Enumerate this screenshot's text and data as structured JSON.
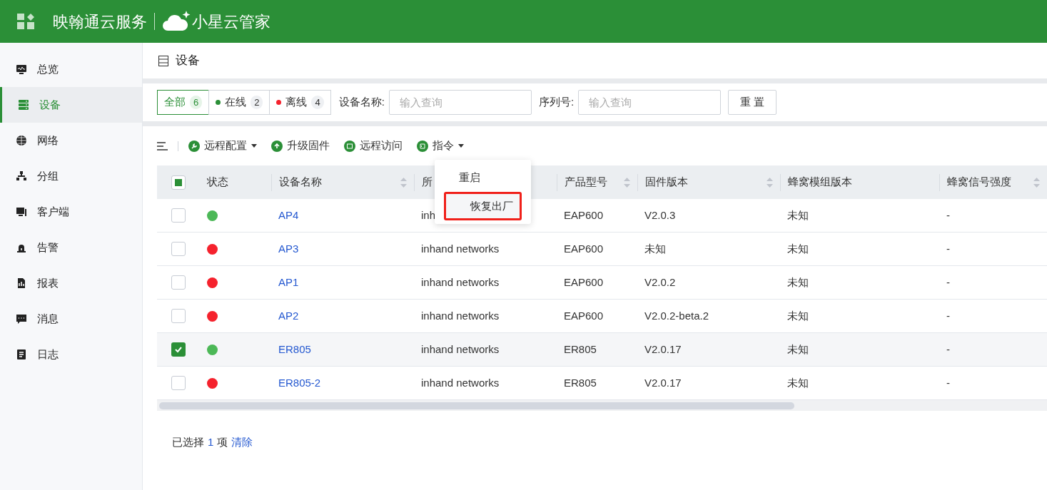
{
  "header": {
    "brand": "映翰通云服务",
    "product": "小星云管家"
  },
  "sidebar": {
    "items": [
      {
        "label": "总览",
        "selected": false
      },
      {
        "label": "设备",
        "selected": true
      },
      {
        "label": "网络",
        "selected": false
      },
      {
        "label": "分组",
        "selected": false
      },
      {
        "label": "客户端",
        "selected": false
      },
      {
        "label": "告警",
        "selected": false
      },
      {
        "label": "报表",
        "selected": false
      },
      {
        "label": "消息",
        "selected": false
      },
      {
        "label": "日志",
        "selected": false
      }
    ]
  },
  "page_title": "设备",
  "filters": {
    "status_tabs": [
      {
        "label": "全部",
        "count": "6",
        "selected": true
      },
      {
        "label": "在线",
        "count": "2",
        "selected": false,
        "color": "#2b8f37"
      },
      {
        "label": "离线",
        "count": "4",
        "selected": false,
        "color": "#f5222d"
      }
    ],
    "fields": [
      {
        "label": "设备名称:",
        "placeholder": "输入查询"
      },
      {
        "label": "序列号:",
        "placeholder": "输入查询"
      }
    ],
    "reset": "重 置"
  },
  "toolbar": [
    {
      "label": "远程配置",
      "dropdown": true
    },
    {
      "label": "升级固件",
      "dropdown": false
    },
    {
      "label": "远程访问",
      "dropdown": false
    },
    {
      "label": "指令",
      "dropdown": true
    }
  ],
  "command_menu": [
    {
      "label": "重启",
      "highlighted": false
    },
    {
      "label": "恢复出厂",
      "highlighted": true
    }
  ],
  "table": {
    "header_checkbox": {
      "indeterminate": true
    },
    "columns": [
      {
        "label": "状态",
        "sortable": false
      },
      {
        "label": "设备名称",
        "sortable": true
      },
      {
        "label": "所",
        "sortable": false
      },
      {
        "label": "产品型号",
        "sortable": true
      },
      {
        "label": "固件版本",
        "sortable": true
      },
      {
        "label": "蜂窝模组版本",
        "sortable": false
      },
      {
        "label": "蜂窝信号强度",
        "sortable": true
      }
    ],
    "rows": [
      {
        "checked": false,
        "online": true,
        "name": "AP4",
        "org": "inh",
        "model": "EAP600",
        "firmware": "V2.0.3",
        "module": "未知",
        "signal": "-"
      },
      {
        "checked": false,
        "online": false,
        "name": "AP3",
        "org": "inhand networks",
        "model": "EAP600",
        "firmware": "未知",
        "module": "未知",
        "signal": "-"
      },
      {
        "checked": false,
        "online": false,
        "name": "AP1",
        "org": "inhand networks",
        "model": "EAP600",
        "firmware": "V2.0.2",
        "module": "未知",
        "signal": "-"
      },
      {
        "checked": false,
        "online": false,
        "name": "AP2",
        "org": "inhand networks",
        "model": "EAP600",
        "firmware": "V2.0.2-beta.2",
        "module": "未知",
        "signal": "-"
      },
      {
        "checked": true,
        "online": true,
        "name": "ER805",
        "org": "inhand networks",
        "model": "ER805",
        "firmware": "V2.0.17",
        "module": "未知",
        "signal": "-"
      },
      {
        "checked": false,
        "online": false,
        "name": "ER805-2",
        "org": "inhand networks",
        "model": "ER805",
        "firmware": "V2.0.17",
        "module": "未知",
        "signal": "-"
      }
    ]
  },
  "footer": {
    "prefix": "已选择",
    "count": "1",
    "unit": "项",
    "clear": "清除"
  }
}
